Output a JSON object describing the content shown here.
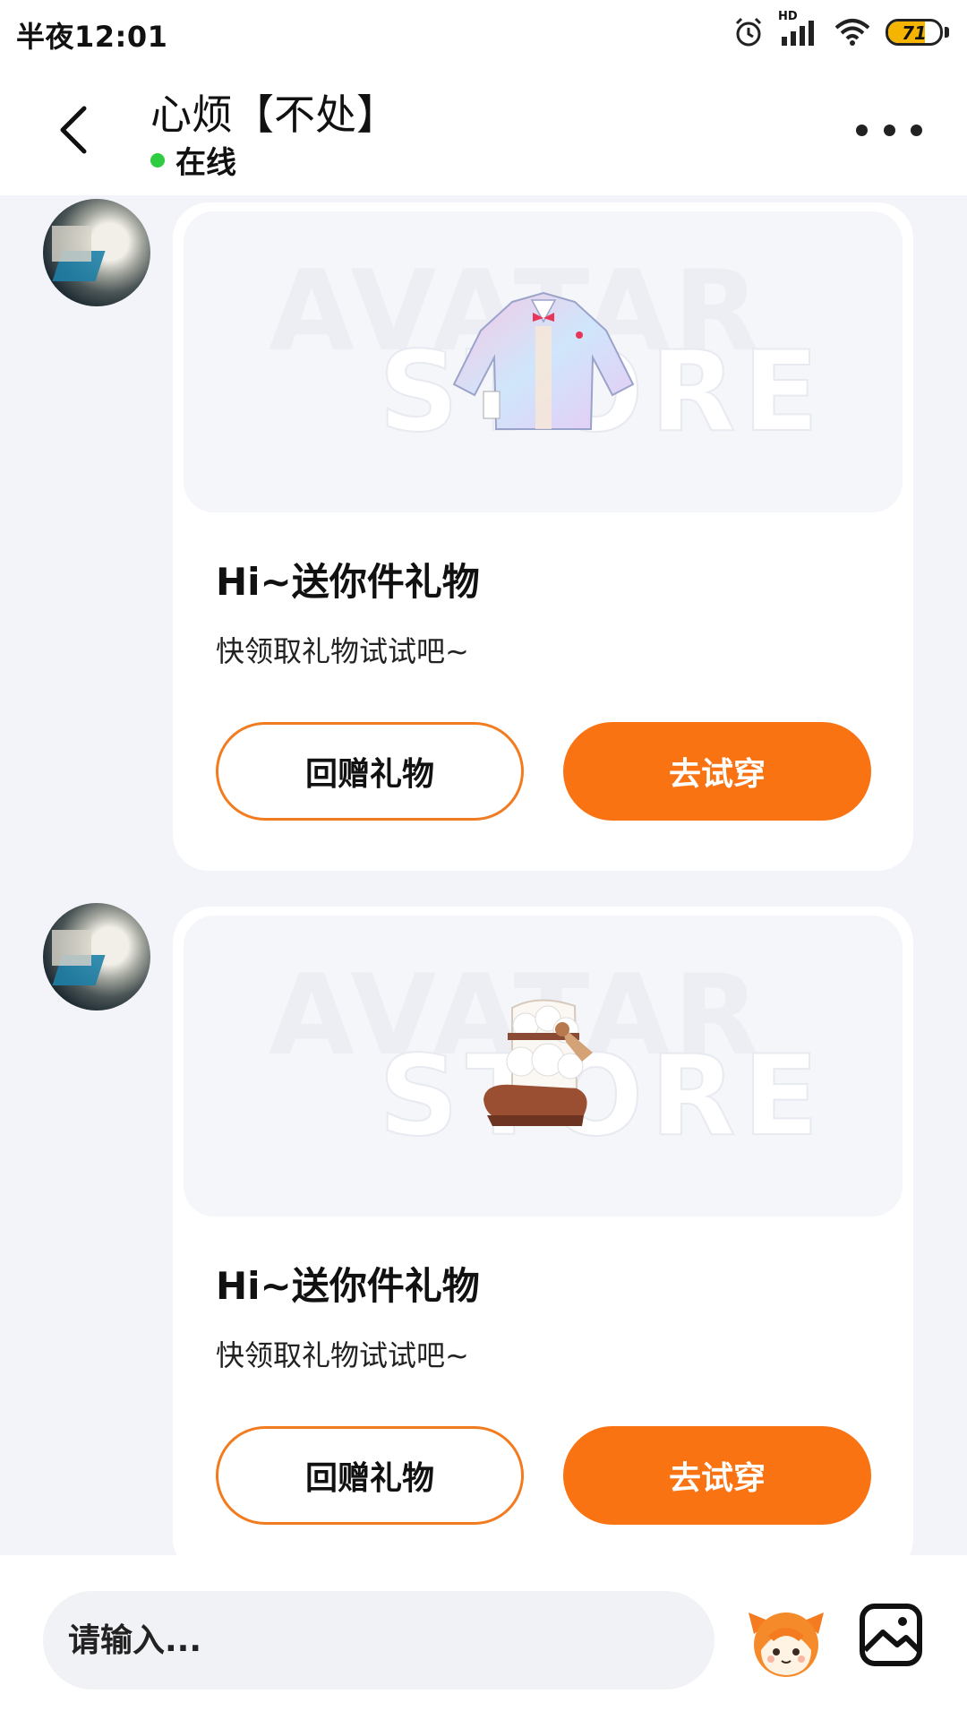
{
  "status_bar": {
    "time": "半夜12:01",
    "network_label": "HD",
    "battery_level": "71",
    "battery_fraction": 0.71
  },
  "header": {
    "title": "心烦【不处】",
    "status": "在线",
    "back_icon": "chevron-left-icon",
    "more_icon": "more-horizontal-icon"
  },
  "messages": [
    {
      "image_watermark": [
        "AVATAR",
        "STORE"
      ],
      "item": "jacket",
      "title": "Hi~送你件礼物",
      "subtitle": "快领取礼物试试吧~",
      "return_gift_label": "回赠礼物",
      "try_on_label": "去试穿"
    },
    {
      "image_watermark": [
        "AVATAR",
        "STORE"
      ],
      "item": "boots",
      "title": "Hi~送你件礼物",
      "subtitle": "快领取礼物试试吧~",
      "return_gift_label": "回赠礼物",
      "try_on_label": "去试穿"
    }
  ],
  "input": {
    "placeholder": "请输入..."
  },
  "colors": {
    "accent": "#fa7313",
    "online": "#2ecc40",
    "background": "#f3f4f9"
  }
}
